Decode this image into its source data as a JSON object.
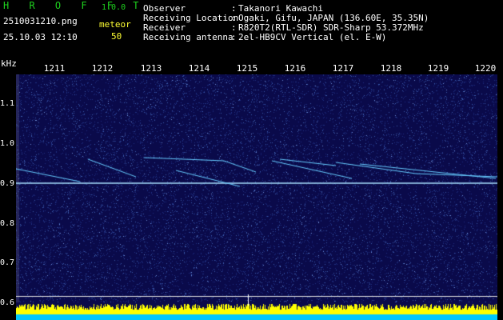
{
  "header": {
    "brand": "H R O F F T",
    "version": "1.0.0",
    "filename": "2510031210.png",
    "mode": "meteor",
    "datetime": "25.10.03 12:10",
    "count": "50"
  },
  "info": [
    {
      "label": "Observer",
      "sep": ":",
      "value": "Takanori Kawachi"
    },
    {
      "label": "Receiving Location",
      "sep": ":",
      "value": "Ogaki, Gifu, JAPAN (136.60E, 35.35N)"
    },
    {
      "label": "Receiver",
      "sep": ":",
      "value": "R820T2(RTL-SDR) SDR-Sharp 53.372MHz"
    },
    {
      "label": "Receiving antenna",
      "sep": ":",
      "value": "2el-HB9CV Vertical (el. E-W)"
    }
  ],
  "spectrogram": {
    "freq_unit": "kHz",
    "time_ticks": [
      "1211",
      "1212",
      "1213",
      "1214",
      "1215",
      "1216",
      "1217",
      "1218",
      "1219",
      "1220"
    ],
    "freq_ticks": [
      "1.1",
      "1.0",
      "0.9",
      "0.8",
      "0.7",
      "0.6"
    ],
    "colors": {
      "background": "#0a0a4a",
      "noise": "#3a5aaa",
      "carrier": "#a8e0ff",
      "trace": "#66ccff",
      "level": "#ffff00",
      "baseline": "#00c8ff"
    }
  }
}
